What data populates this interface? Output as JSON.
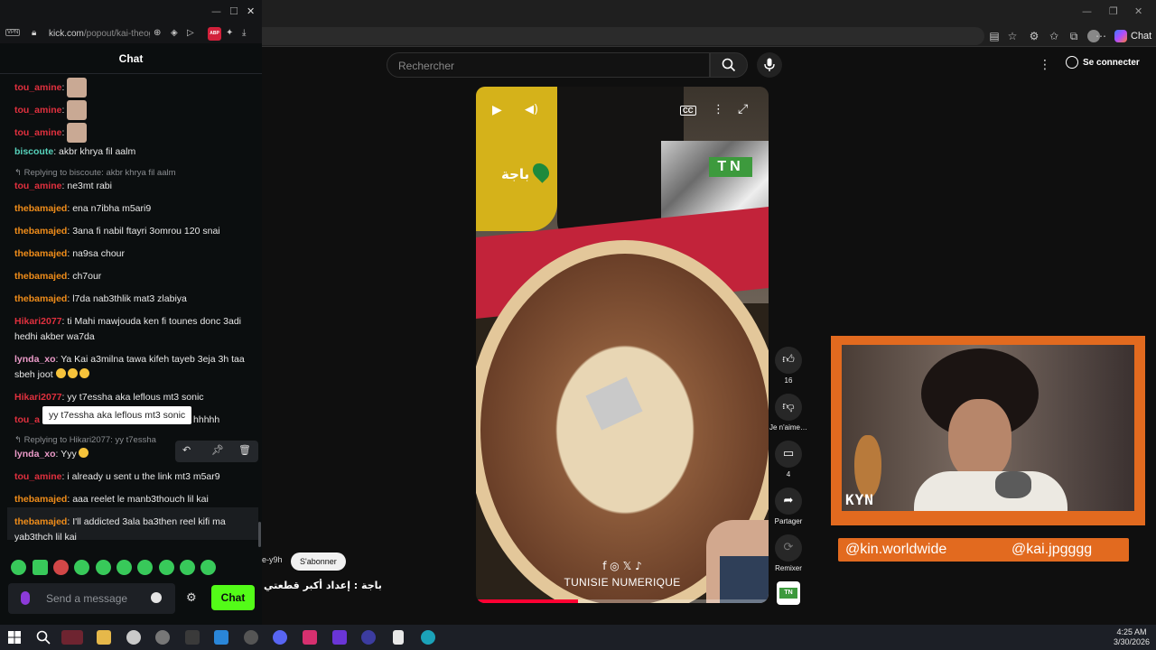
{
  "kick": {
    "url_main": "kick.com",
    "url_rest": "/popout/kai-theog",
    "vpn_label": "VPN",
    "abp_label": "ABP",
    "chat_title": "Chat",
    "tooltip": "yy t7essha aka leflous mt3 sonic",
    "composer_placeholder": "Send a message",
    "send_label": "Chat",
    "messages": [
      {
        "user": "tou_amine",
        "text": ""
      },
      {
        "user": "tou_amine",
        "text": ""
      },
      {
        "user": "tou_amine",
        "text": ""
      },
      {
        "user": "biscoute",
        "text": "akbr khrya fil aalm"
      },
      {
        "user": "tou_amine",
        "text": "ne3mt rabi",
        "reply": "Replying to biscoute: akbr khrya fil aalm"
      },
      {
        "user": "thebamajed",
        "text": "ena n7ibha m5ari9"
      },
      {
        "user": "thebamajed",
        "text": "3ana fi nabil ftayri 3omrou 120 snai"
      },
      {
        "user": "thebamajed",
        "text": "na9sa chour"
      },
      {
        "user": "thebamajed",
        "text": "ch7our"
      },
      {
        "user": "thebamajed",
        "text": "l7da nab3thlik mat3 zlabiya"
      },
      {
        "user": "Hikari2077",
        "text": "ti Mahi mawjouda ken fi tounes donc 3adi hedhi akber wa7da"
      },
      {
        "user": "lynda_xo",
        "text": "Ya Kai a3milna tawa kifeh tayeb 3eja 3h taa sbeh joot"
      },
      {
        "user": "Hikari2077",
        "text": "yy t7essha aka leflous mt3 sonic"
      },
      {
        "user": "tou_a",
        "text": "hhhhh"
      },
      {
        "user": "lynda_xo",
        "text": "Yyy",
        "reply": "Replying to Hikari2077: yy t7essha"
      },
      {
        "user": "tou_amine",
        "text": "i already u sent u the link mt3 m5ar9"
      },
      {
        "user": "thebamajed",
        "text": "aaa reelet le manb3thouch lil kai"
      },
      {
        "user": "thebamajed",
        "text": "I'll addicted 3ala ba3then reel kifi ma yab3thch lil kai"
      }
    ]
  },
  "youtube": {
    "search_placeholder": "Rechercher",
    "signin_label": "Se connecter",
    "chat_button": "Chat",
    "video": {
      "location_ar": "باجة",
      "tn_logo": "TN",
      "social_icons": "f ◎ 𝕏 ♪",
      "brand": "TUNISIE NUMERIQUE",
      "cc": "CC",
      "progress": 0.35
    },
    "actions": {
      "likes": "16",
      "dislike_label": "Je n'aime…",
      "comments": "4",
      "share_label": "Partager",
      "remix_label": "Remixer"
    },
    "channel_fragment": "e-y9h",
    "subscribe_label": "S'abonner",
    "title_ar": "باجة : إعداد أكبر قطعتي"
  },
  "stream": {
    "cam_tag": "KYN",
    "handle_left": "@kin.worldwide",
    "handle_right": "@kai.jpgggg"
  },
  "taskbar": {
    "time": "4:25 AM",
    "date": "3/30/2026"
  },
  "colors": {
    "kick_green": "#53fc18",
    "user_red": "#e0303e",
    "user_orange": "#f08d1a",
    "user_teal": "#57d3bc",
    "user_pink": "#ec9bc9",
    "stream_orange": "#e26a1f"
  }
}
